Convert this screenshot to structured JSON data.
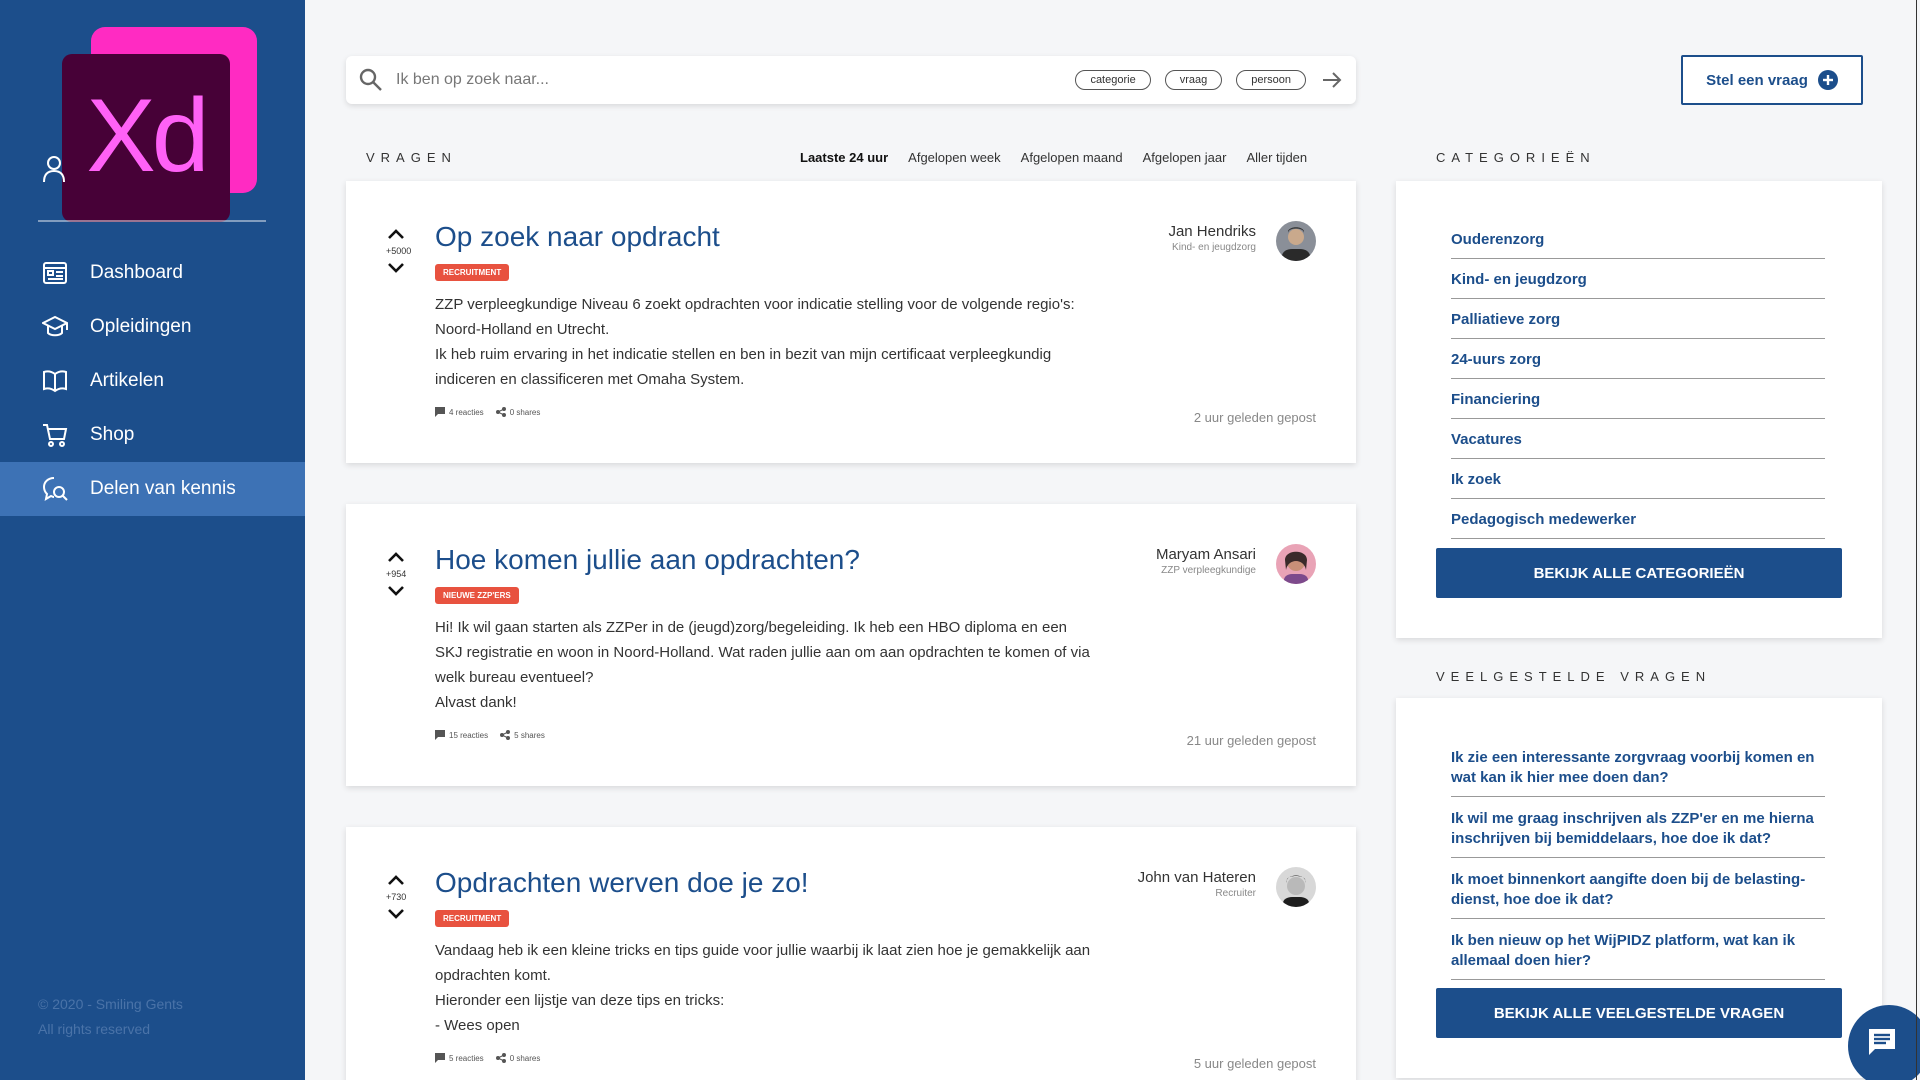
{
  "sidebar": {
    "logo_text": "Xd",
    "nav": [
      {
        "label": "Dashboard",
        "icon": "dashboard-icon"
      },
      {
        "label": "Opleidingen",
        "icon": "graduation-cap-icon"
      },
      {
        "label": "Artikelen",
        "icon": "open-book-icon"
      },
      {
        "label": "Shop",
        "icon": "cart-icon"
      },
      {
        "label": "Delen van kennis",
        "icon": "chat-search-icon",
        "active": true
      }
    ],
    "footer_line1": "© 2020 - Smiling Gents",
    "footer_line2": "All rights reserved"
  },
  "search": {
    "placeholder": "Ik ben op zoek naar...",
    "chips": [
      "categorie",
      "vraag",
      "persoon"
    ]
  },
  "ask_button": "Stel een vraag",
  "questions_section": {
    "title": "VRAGEN",
    "filters": [
      "Laatste 24 uur",
      "Afgelopen week",
      "Afgelopen maand",
      "Afgelopen jaar",
      "Aller tijden"
    ],
    "active_filter": "Laatste 24 uur"
  },
  "questions": [
    {
      "votes": "+5000",
      "title": "Op zoek naar opdracht",
      "tag": "RECRUITMENT",
      "body": [
        "ZZP verpleegkundige Niveau 6 zoekt opdrachten voor indicatie stelling voor de volgende regio's:",
        "Noord-Holland en Utrecht.",
        "Ik heb ruim ervaring in het indicatie stellen en ben in bezit van mijn certificaat verpleegkundig",
        "indiceren en classificeren met Omaha System."
      ],
      "reactions": "4 reacties",
      "shares": "0 shares",
      "author": "Jan Hendriks",
      "role": "Kind- en jeugdzorg",
      "posted": "2 uur geleden gepost"
    },
    {
      "votes": "+954",
      "title": "Hoe komen jullie aan opdrachten?",
      "tag": "NIEUWE ZZP'ERS",
      "body": [
        "Hi! Ik wil gaan starten als ZZPer in de (jeugd)zorg/begeleiding. Ik heb een HBO diploma en een",
        "SKJ registratie en woon in Noord-Holland. Wat raden jullie aan om aan opdrachten te komen of via",
        "welk bureau eventueel?",
        "Alvast dank!"
      ],
      "reactions": "15 reacties",
      "shares": "5 shares",
      "author": "Maryam Ansari",
      "role": "ZZP verpleegkundige",
      "posted": "21 uur geleden gepost"
    },
    {
      "votes": "+730",
      "title": "Opdrachten werven doe je zo!",
      "tag": "RECRUITMENT",
      "body": [
        "Vandaag heb ik een kleine tricks en tips guide voor jullie waarbij ik laat zien hoe je gemakkelijk aan",
        "opdrachten komt.",
        "Hieronder een lijstje van deze tips en tricks:",
        "- Wees open"
      ],
      "reactions": "5  reacties",
      "shares": "0 shares",
      "author": "John van Hateren",
      "role": "Recruiter",
      "posted": "5 uur geleden gepost"
    }
  ],
  "categories_section": {
    "title": "CATEGORIEËN",
    "items": [
      "Ouderenzorg",
      "Kind- en jeugdzorg",
      "Palliatieve zorg",
      "24-uurs zorg",
      "Financiering",
      "Vacatures",
      "Ik zoek",
      "Pedagogisch medewerker"
    ],
    "button": "BEKIJK ALLE CATEGORIEËN"
  },
  "faq_section": {
    "title": "VEELGESTELDE VRAGEN",
    "items": [
      "Ik zie een interessante zorgvraag voorbij komen en wat kan ik hier mee doen dan?",
      "Ik wil me graag inschrijven als ZZP'er en me hierna inschrijven bij bemiddelaars, hoe doe ik dat?",
      "Ik moet binnenkort aangifte doen bij de belasting-dienst, hoe doe ik dat?",
      "Ik ben nieuw op het WijPIDZ platform, wat kan ik allemaal doen hier?"
    ],
    "button": "BEKIJK ALLE VEELGESTELDE VRAGEN"
  },
  "colors": {
    "primary": "#1c4e8b",
    "sidebar_active": "#3d72b5",
    "tag": "#e8523f",
    "xd_pink": "#ff2bc2",
    "xd_dark": "#470137"
  }
}
